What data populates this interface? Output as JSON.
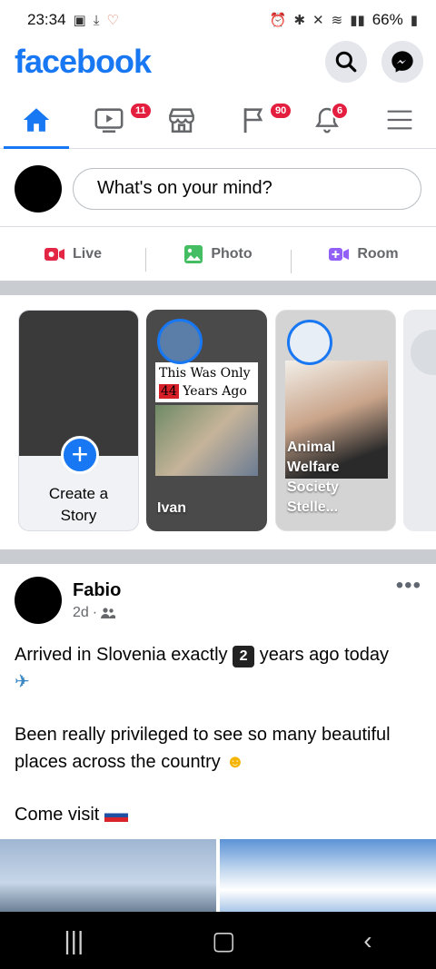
{
  "status_bar": {
    "time": "23:34",
    "battery": "66%"
  },
  "header": {
    "logo": "facebook",
    "icons": [
      "search-icon",
      "messenger-icon"
    ]
  },
  "nav": {
    "tabs": [
      {
        "name": "home",
        "badge": ""
      },
      {
        "name": "watch",
        "badge": "11"
      },
      {
        "name": "marketplace",
        "badge": ""
      },
      {
        "name": "groups",
        "badge": "90"
      },
      {
        "name": "notifications",
        "badge": "6"
      },
      {
        "name": "menu",
        "badge": ""
      }
    ]
  },
  "composer": {
    "placeholder": "What's on your mind?"
  },
  "actions": {
    "live": "Live",
    "photo": "Photo",
    "room": "Room"
  },
  "stories": {
    "create_label_1": "Create a",
    "create_label_2": "Story",
    "items": [
      {
        "name": "Ivan",
        "caption_line1": "This Was Only",
        "caption_num": "44",
        "caption_line2": "Years Ago"
      },
      {
        "name": "Animal Welfare Society Stelle..."
      }
    ]
  },
  "post": {
    "author": "Fabio",
    "time": "2d",
    "line1_before": "Arrived in Slovenia exactly",
    "line1_num": "2",
    "line1_after": "years ago today",
    "para2": "Been really privileged to see so many beautiful places across the country",
    "para3": "Come visit"
  },
  "colors": {
    "brand": "#1877f2",
    "badge": "#e41e3f",
    "live": "#e42645",
    "photo": "#45bd62",
    "room": "#9360f7"
  }
}
